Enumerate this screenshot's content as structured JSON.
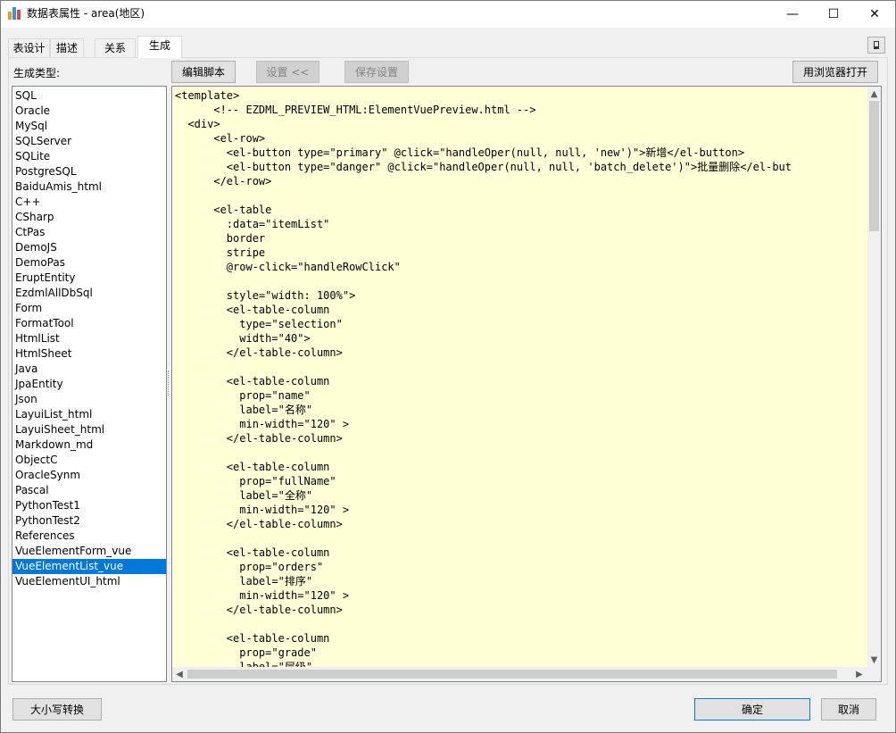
{
  "window": {
    "title": "数据表属性 - area(地区)",
    "controls": {
      "minimize": "—",
      "maximize": "☐",
      "close": "✕"
    }
  },
  "tabs": [
    {
      "label": "表设计",
      "active": false
    },
    {
      "label": "描述",
      "active": false
    },
    {
      "label": "关系",
      "active": false
    },
    {
      "label": "生成",
      "active": true
    }
  ],
  "pin_label": "📌",
  "generate": {
    "type_label": "生成类型:",
    "buttons": {
      "edit_script": "编辑脚本",
      "settings": "设置 <<",
      "save_settings": "保存设置",
      "open_browser": "用浏览器打开"
    },
    "types": [
      "SQL",
      "Oracle",
      "MySql",
      "SQLServer",
      "SQLite",
      "PostgreSQL",
      "BaiduAmis_html",
      "C++",
      "CSharp",
      "CtPas",
      "DemoJS",
      "DemoPas",
      "EruptEntity",
      "EzdmlAllDbSql",
      "Form",
      "FormatTool",
      "HtmlList",
      "HtmlSheet",
      "Java",
      "JpaEntity",
      "Json",
      "LayuiList_html",
      "LayuiSheet_html",
      "Markdown_md",
      "ObjectC",
      "OracleSynm",
      "Pascal",
      "PythonTest1",
      "PythonTest2",
      "References",
      "VueElementForm_vue",
      "VueElementList_vue",
      "VueElementUI_html"
    ],
    "selected_type": "VueElementList_vue",
    "code": "<template>\n      <!-- EZDML_PREVIEW_HTML:ElementVuePreview.html -->\n  <div>\n      <el-row>\n        <el-button type=\"primary\" @click=\"handleOper(null, null, 'new')\">新增</el-button>\n        <el-button type=\"danger\" @click=\"handleOper(null, null, 'batch_delete')\">批量删除</el-but\n      </el-row>\n\n      <el-table\n        :data=\"itemList\"\n        border\n        stripe\n        @row-click=\"handleRowClick\"\n\n        style=\"width: 100%\">\n        <el-table-column\n          type=\"selection\"\n          width=\"40\">\n        </el-table-column>\n\n        <el-table-column\n          prop=\"name\"\n          label=\"名称\"\n          min-width=\"120\" >\n        </el-table-column>\n\n        <el-table-column\n          prop=\"fullName\"\n          label=\"全称\"\n          min-width=\"120\" >\n        </el-table-column>\n\n        <el-table-column\n          prop=\"orders\"\n          label=\"排序\"\n          min-width=\"120\" >\n        </el-table-column>\n\n        <el-table-column\n          prop=\"grade\"\n          label=\"层级\""
  },
  "footer": {
    "case_convert": "大小写转换",
    "ok": "确定",
    "cancel": "取消"
  },
  "colors": {
    "code_background": "#ffffd8",
    "selection": "#0078d7",
    "accent_border": "#0078d7"
  }
}
